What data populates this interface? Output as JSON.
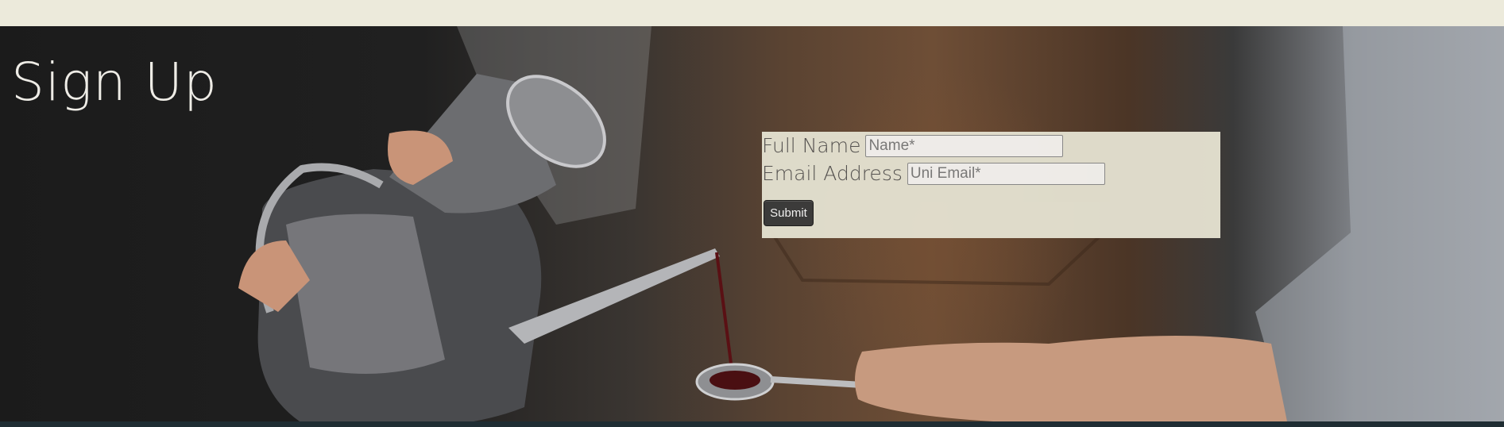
{
  "page": {
    "title": "Sign Up"
  },
  "form": {
    "name_label": "Full Name",
    "name_placeholder": "Name*",
    "email_label": "Email Address",
    "email_placeholder": "Uni Email*",
    "submit_label": "Submit"
  },
  "colors": {
    "top_bar": "#eceadb",
    "form_panel": "#e3e0cf",
    "submit_button": "#3b3b3b",
    "title_text": "#eeece6"
  }
}
